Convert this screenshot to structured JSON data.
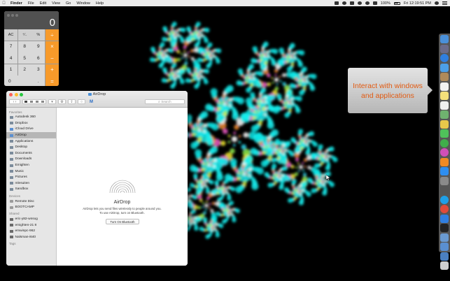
{
  "menubar": {
    "apple": "",
    "items": [
      "Finder",
      "File",
      "Edit",
      "View",
      "Go",
      "Window",
      "Help"
    ],
    "battery": "100%",
    "clock": "Fri 12:19:51 PM"
  },
  "calculator": {
    "display": "0",
    "keys": [
      {
        "label": "AC",
        "kind": "fn"
      },
      {
        "label": "⁺∕₋",
        "kind": "fn"
      },
      {
        "label": "%",
        "kind": "fn"
      },
      {
        "label": "÷",
        "kind": "op"
      },
      {
        "label": "7",
        "kind": "num"
      },
      {
        "label": "8",
        "kind": "num"
      },
      {
        "label": "9",
        "kind": "num"
      },
      {
        "label": "×",
        "kind": "op"
      },
      {
        "label": "4",
        "kind": "num"
      },
      {
        "label": "5",
        "kind": "num"
      },
      {
        "label": "6",
        "kind": "num"
      },
      {
        "label": "−",
        "kind": "op"
      },
      {
        "label": "1",
        "kind": "num"
      },
      {
        "label": "2",
        "kind": "num"
      },
      {
        "label": "3",
        "kind": "num"
      },
      {
        "label": "+",
        "kind": "op"
      },
      {
        "label": "0",
        "kind": "num zero"
      },
      {
        "label": ".",
        "kind": "num"
      },
      {
        "label": "=",
        "kind": "op"
      }
    ]
  },
  "finder": {
    "title": "AirDrop",
    "search_placeholder": "Search",
    "sidebar": [
      {
        "type": "head",
        "label": "Favorites"
      },
      {
        "type": "item",
        "label": "Autodesk 360",
        "icon": "folder-icon"
      },
      {
        "type": "item",
        "label": "Dropbox",
        "icon": "folder-icon"
      },
      {
        "type": "item",
        "label": "iCloud Drive",
        "icon": "cloud-icon"
      },
      {
        "type": "item",
        "label": "AirDrop",
        "icon": "airdrop-icon",
        "selected": true
      },
      {
        "type": "item",
        "label": "Applications",
        "icon": "applications-icon"
      },
      {
        "type": "item",
        "label": "Desktop",
        "icon": "desktop-icon"
      },
      {
        "type": "item",
        "label": "Documents",
        "icon": "documents-icon"
      },
      {
        "type": "item",
        "label": "Downloads",
        "icon": "downloads-icon"
      },
      {
        "type": "item",
        "label": "Emighten",
        "icon": "home-icon"
      },
      {
        "type": "item",
        "label": "Music",
        "icon": "music-icon"
      },
      {
        "type": "item",
        "label": "Pictures",
        "icon": "pictures-icon"
      },
      {
        "type": "item",
        "label": "mlesuiten",
        "icon": "folder-icon"
      },
      {
        "type": "item",
        "label": "Sandbox",
        "icon": "folder-icon"
      },
      {
        "type": "head",
        "label": "Devices"
      },
      {
        "type": "item",
        "label": "Remote Disc",
        "icon": "disc-icon"
      },
      {
        "type": "item",
        "label": "BOOTCAMP",
        "icon": "disk-icon"
      },
      {
        "type": "head",
        "label": "Shared"
      },
      {
        "type": "item",
        "label": "eric-y82-wnsxg",
        "icon": "network-computer-icon"
      },
      {
        "type": "item",
        "label": "emighten-21 8",
        "icon": "network-computer-icon"
      },
      {
        "type": "item",
        "label": "emwinpc-962",
        "icon": "network-computer-icon"
      },
      {
        "type": "item",
        "label": "Nalsman-i640",
        "icon": "network-computer-icon"
      },
      {
        "type": "head",
        "label": "Tags"
      }
    ],
    "airdrop": {
      "title": "AirDrop",
      "description_line1": "AirDrop lets you send files wirelessly to people around you.",
      "description_line2": "To use AirDrop, turn on Bluetooth.",
      "button": "Turn On Bluetooth"
    }
  },
  "callout": {
    "text": "Interact with windows and applications",
    "color": "#e25b12"
  },
  "dock": {
    "icons": [
      {
        "name": "finder-icon",
        "color": "#4a90d9"
      },
      {
        "name": "launchpad-icon",
        "color": "#6b6b8a"
      },
      {
        "name": "safari-icon",
        "color": "#2f7fe0"
      },
      {
        "name": "mail-icon",
        "color": "#4c9fe8"
      },
      {
        "name": "contacts-icon",
        "color": "#b08a5a"
      },
      {
        "name": "calendar-icon",
        "color": "#f2f2f2"
      },
      {
        "name": "notes-icon",
        "color": "#f4e07a"
      },
      {
        "name": "reminders-icon",
        "color": "#f0f0f0"
      },
      {
        "name": "maps-icon",
        "color": "#6fb36f"
      },
      {
        "name": "photos-icon",
        "color": "#e8c84a"
      },
      {
        "name": "messages-icon",
        "color": "#4fc25a"
      },
      {
        "name": "facetime-icon",
        "color": "#3fae4a"
      },
      {
        "name": "itunes-icon",
        "color": "#d04fb8"
      },
      {
        "name": "ibooks-icon",
        "color": "#f08a24"
      },
      {
        "name": "app-store-icon",
        "color": "#2e8ef0"
      },
      {
        "name": "system-preferences-icon",
        "color": "#8a8a8a"
      },
      {
        "name": "calculator-icon",
        "color": "#555555"
      },
      {
        "name": "skype-icon",
        "color": "#1ea0e8"
      },
      {
        "name": "chrome-icon",
        "color": "#e04a3a"
      },
      {
        "name": "dropbox-icon",
        "color": "#2f7ee0"
      },
      {
        "name": "terminal-icon",
        "color": "#222222"
      },
      {
        "name": "preview-icon",
        "color": "#6a9ad0"
      },
      {
        "name": "folder-icon",
        "color": "#5a8fd0"
      },
      {
        "name": "downloads-stack-icon",
        "color": "#4a7fc0"
      },
      {
        "name": "trash-icon",
        "color": "#cfcfcf"
      }
    ]
  }
}
